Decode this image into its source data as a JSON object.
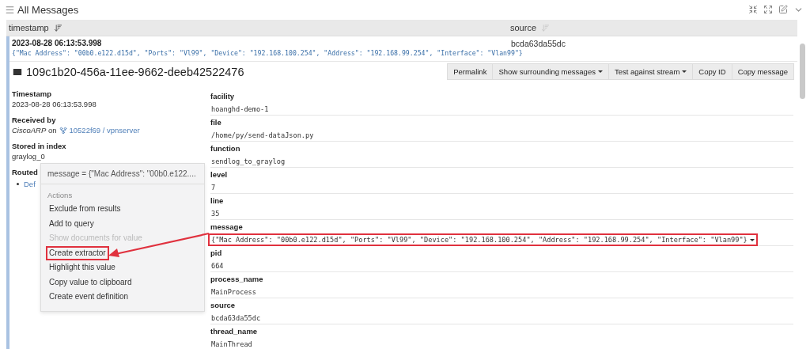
{
  "panel": {
    "title": "All Messages"
  },
  "table": {
    "columns": [
      {
        "label": "timestamp",
        "sort_active": true
      },
      {
        "label": "source",
        "sort_active": false
      }
    ],
    "rows": [
      {
        "timestamp": "2023-08-28 06:13:53.998",
        "message": "{\"Mac Address\": \"00b0.e122.d15d\", \"Ports\": \"Vl99\", \"Device\": \"192.168.100.254\", \"Address\": \"192.168.99.254\", \"Interface\": \"Vlan99\"}",
        "source": "bcda63da55dc"
      }
    ]
  },
  "detail": {
    "id": "109c1b20-456a-11ee-9662-deeb42522476",
    "actions": [
      {
        "label": "Permalink",
        "dropdown": false
      },
      {
        "label": "Show surrounding messages",
        "dropdown": true
      },
      {
        "label": "Test against stream",
        "dropdown": true
      },
      {
        "label": "Copy ID",
        "dropdown": false
      },
      {
        "label": "Copy message",
        "dropdown": false
      }
    ],
    "meta": [
      {
        "kind": "plain",
        "label": "Timestamp",
        "value": "2023-08-28 06:13:53.998"
      },
      {
        "kind": "received",
        "label": "Received by",
        "value": "*CiscoARP* on",
        "link": "10522f69 / vpnserver"
      },
      {
        "kind": "plain",
        "label": "Stored in index",
        "value": "graylog_0"
      },
      {
        "kind": "streams",
        "label": "Routed",
        "value": "Def"
      }
    ],
    "fields": [
      {
        "name": "facility",
        "value": "hoanghd-demo-1",
        "highlighted": false,
        "has_menu": false
      },
      {
        "name": "file",
        "value": "/home/py/send-dataJson.py",
        "highlighted": false,
        "has_menu": false
      },
      {
        "name": "function",
        "value": "sendlog_to_graylog",
        "highlighted": false,
        "has_menu": false
      },
      {
        "name": "level",
        "value": "7",
        "highlighted": false,
        "has_menu": false
      },
      {
        "name": "line",
        "value": "35",
        "highlighted": false,
        "has_menu": false
      },
      {
        "name": "message",
        "value": "{\"Mac Address\": \"00b0.e122.d15d\", \"Ports\": \"Vl99\", \"Device\": \"192.168.100.254\", \"Address\": \"192.168.99.254\", \"Interface\": \"Vlan99\"}",
        "highlighted": true,
        "has_menu": true
      },
      {
        "name": "pid",
        "value": "664",
        "highlighted": false,
        "has_menu": false
      },
      {
        "name": "process_name",
        "value": "MainProcess",
        "highlighted": false,
        "has_menu": false
      },
      {
        "name": "source",
        "value": "bcda63da55dc",
        "highlighted": false,
        "has_menu": false
      },
      {
        "name": "thread_name",
        "value": "MainThread",
        "highlighted": false,
        "has_menu": false
      }
    ]
  },
  "context_menu": {
    "title": "message = {\"Mac Address\": \"00b0.e122....",
    "section": "Actions",
    "items": [
      {
        "label": "Exclude from results",
        "disabled": false,
        "highlighted": false
      },
      {
        "label": "Add to query",
        "disabled": false,
        "highlighted": false
      },
      {
        "label": "Show documents for value",
        "disabled": true,
        "highlighted": false
      },
      {
        "label": "Create extractor",
        "disabled": false,
        "highlighted": true
      },
      {
        "label": "Highlight this value",
        "disabled": false,
        "highlighted": false
      },
      {
        "label": "Copy value to clipboard",
        "disabled": false,
        "highlighted": false
      },
      {
        "label": "Create event definition",
        "disabled": false,
        "highlighted": false
      }
    ]
  }
}
